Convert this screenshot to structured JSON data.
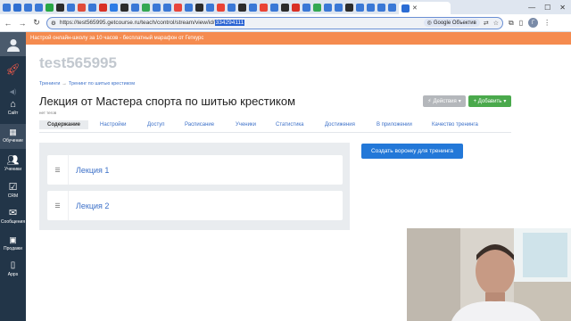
{
  "browser": {
    "active_tab_title": "",
    "url_prefix": "https://test565995.getcourse.ru/teach/control/stream/view/id/",
    "url_selected": "334294111",
    "lens_label": "Google Объектив",
    "profile_initial": "Г",
    "favicon_colors": [
      "#3a78d6",
      "#2f6fd1",
      "#3a78d6",
      "#3a78d6",
      "#28a745",
      "#2c2c2c",
      "#3a78d6",
      "#e04b3a",
      "#3a78d6",
      "#d93025",
      "#2c7be5",
      "#2c2c2c",
      "#3a78d6",
      "#34a853",
      "#3a78d6",
      "#3a78d6",
      "#e8453c",
      "#3a78d6",
      "#2c2c2c",
      "#3a78d6",
      "#ea4335",
      "#3a78d6",
      "#2c2c2c",
      "#3a78d6",
      "#ea4335",
      "#3a78d6",
      "#2c2c2c",
      "#d93025",
      "#3a78d6",
      "#34a853",
      "#3a78d6",
      "#3a78d6",
      "#2c2c2c",
      "#3a78d6",
      "#3a78d6",
      "#3a78d6",
      "#3a78d6"
    ]
  },
  "sidebar": {
    "items": [
      {
        "label": "Сайт",
        "icon": "rocket-icon"
      },
      {
        "label": "Обучение",
        "icon": "graduation-icon"
      },
      {
        "label": "Ученики",
        "icon": "users-icon"
      },
      {
        "label": "CRM",
        "icon": "check-square-icon"
      },
      {
        "label": "Сообщения",
        "icon": "envelope-icon"
      },
      {
        "label": "Продажи",
        "icon": "money-icon"
      },
      {
        "label": "Apps",
        "icon": "phone-icon"
      }
    ]
  },
  "banner": {
    "text": "Настрой онлайн-школу за 10 часов - бесплатный марафон от Геткурс"
  },
  "page": {
    "school_name": "test565995",
    "breadcrumbs": [
      "Тренинги",
      "→",
      "Тренинг по шитью крестиком"
    ],
    "title": "Лекция от Мастера спорта по шитью крестиком",
    "tags_note": "нет тегов",
    "actions_label": "Действия",
    "add_label": "+ Добавить",
    "tabs": [
      "Содержание",
      "Настройки",
      "Доступ",
      "Расписание",
      "Ученики",
      "Статистика",
      "Достижения",
      "В приложении",
      "Качество тренинга"
    ],
    "lessons": [
      "Лекция 1",
      "Лекция 2"
    ],
    "funnel_button": "Создать воронку для тренинга"
  },
  "colors": {
    "sidebar_bg": "#223548",
    "banner_bg": "#f58b4f",
    "link_blue": "#3c70c8",
    "primary_blue": "#2378d8",
    "add_green": "#4aa94c",
    "actions_gray": "#b4b7bb"
  }
}
